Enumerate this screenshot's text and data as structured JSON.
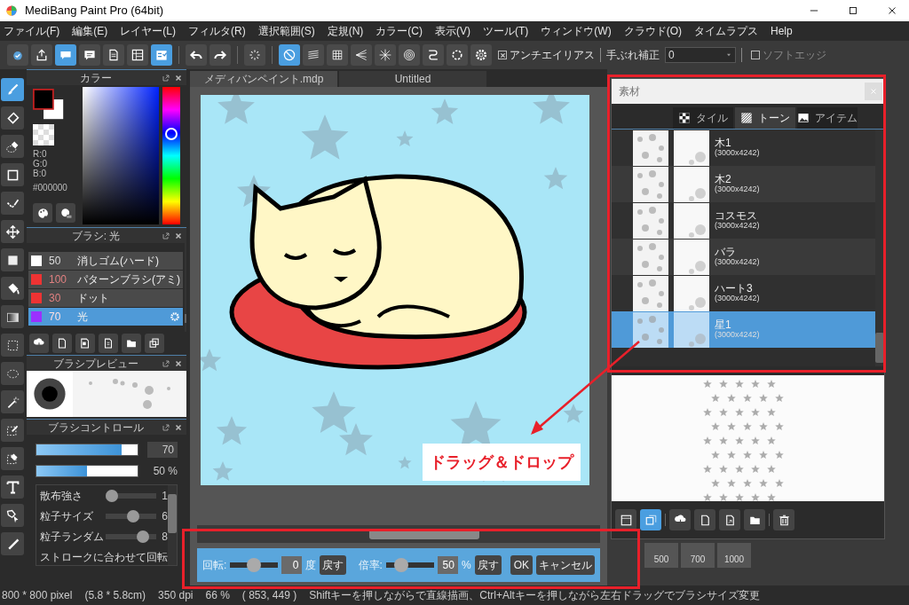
{
  "window": {
    "title": "MediBang Paint Pro (64bit)"
  },
  "menu": [
    "ファイル(F)",
    "編集(E)",
    "レイヤー(L)",
    "フィルタ(R)",
    "選択範囲(S)",
    "定規(N)",
    "カラー(C)",
    "表示(V)",
    "ツール(T)",
    "ウィンドウ(W)",
    "クラウド(O)",
    "タイムラプス",
    "Help"
  ],
  "toolbar": {
    "antialias": {
      "label": "アンチエイリアス",
      "checked": true
    },
    "stabilizer": {
      "label": "手ぶれ補正",
      "value": "0"
    },
    "soft_edge": {
      "label": "ソフトエッジ",
      "checked": false
    }
  },
  "color_panel": {
    "title": "カラー",
    "r": "R:0",
    "g": "G:0",
    "b": "B:0",
    "hex": "#000000"
  },
  "brush_panel": {
    "title": "ブラシ: 光",
    "brushes": [
      {
        "size": "50",
        "name": "消しゴム(ハード)",
        "color": "#ffffff",
        "selected": false
      },
      {
        "size": "100",
        "name": "パターンブラシ(アミ)",
        "color": "#ee3333",
        "selected": false
      },
      {
        "size": "30",
        "name": "ドット",
        "color": "#ee3333",
        "selected": false
      },
      {
        "size": "70",
        "name": "光",
        "color": "#9b30ff",
        "selected": true
      }
    ]
  },
  "brush_preview": {
    "title": "ブラシプレビュー"
  },
  "brush_control": {
    "title": "ブラシコントロール",
    "size": {
      "level": 0.84,
      "value": "70"
    },
    "opacity": {
      "level": 0.5,
      "value": "50 %"
    },
    "params": [
      {
        "label": "散布強さ",
        "level": 0.0,
        "value": "1"
      },
      {
        "label": "粒子サイズ",
        "level": 0.55,
        "value": "6"
      },
      {
        "label": "粒子ランダム",
        "level": 0.8,
        "value": "8"
      }
    ],
    "last_param": "ストロークに合わせて回転"
  },
  "documents": {
    "tabs": [
      {
        "label": "メディバンペイント.mdp",
        "selected": true
      },
      {
        "label": "Untitled",
        "selected": false
      }
    ]
  },
  "annotation": {
    "label": "ドラッグ＆ドロップ"
  },
  "material_panel": {
    "title": "素材",
    "tabs": [
      {
        "label": "タイル",
        "selected": false
      },
      {
        "label": "トーン",
        "selected": true
      },
      {
        "label": "アイテム",
        "selected": false
      }
    ],
    "items": [
      {
        "name": "木1",
        "size": "(3000x4242)",
        "selected": false
      },
      {
        "name": "木2",
        "size": "(3000x4242)",
        "selected": false
      },
      {
        "name": "コスモス",
        "size": "(3000x4242)",
        "selected": false
      },
      {
        "name": "バラ",
        "size": "(3000x4242)",
        "selected": false
      },
      {
        "name": "ハート3",
        "size": "(3000x4242)",
        "selected": false
      },
      {
        "name": "星1",
        "size": "(3000x4242)",
        "selected": true
      }
    ]
  },
  "transform_bar": {
    "rotation": {
      "label": "回転:",
      "level": 0.5,
      "value": "0",
      "unit": "度",
      "reset": "戻す"
    },
    "scale": {
      "label": "倍率:",
      "level": 0.25,
      "value": "50",
      "unit": "%",
      "reset": "戻す"
    },
    "ok": "OK",
    "cancel": "キャンセル"
  },
  "background_panel": {
    "sizes": [
      "500",
      "700",
      "1000"
    ]
  },
  "status_bar": {
    "dimensions": "800 * 800 pixel",
    "physical": "(5.8 * 5.8cm)",
    "dpi": "350 dpi",
    "zoom": "66 %",
    "cursor": "( 853, 449 )",
    "hint": "Shiftキーを押しながらで直線描画、Ctrl+Altキーを押しながら左右ドラッグでブラシサイズ変更"
  }
}
